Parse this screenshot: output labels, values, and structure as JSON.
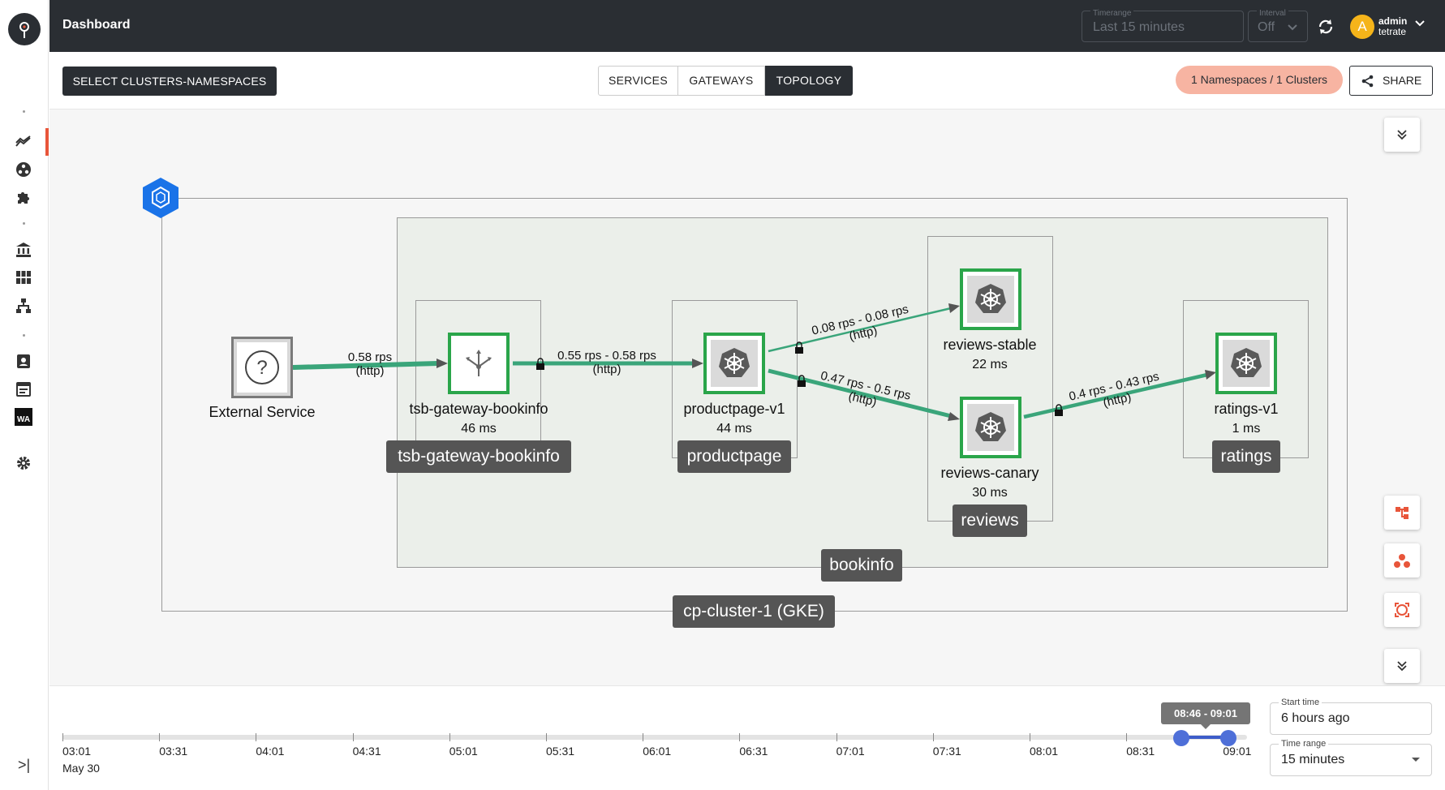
{
  "header": {
    "title": "Dashboard",
    "timerange_label": "Timerange",
    "timerange_value": "Last 15 minutes",
    "interval_label": "Interval",
    "interval_value": "Off",
    "user_initial": "A",
    "user_name": "admin",
    "user_org": "tetrate"
  },
  "toolbar": {
    "select_button": "SELECT CLUSTERS-NAMESPACES",
    "tabs": [
      {
        "label": "SERVICES",
        "active": false
      },
      {
        "label": "GATEWAYS",
        "active": false
      },
      {
        "label": "TOPOLOGY",
        "active": true
      }
    ],
    "namespace_badge": "1 Namespaces / 1 Clusters",
    "share_label": "SHARE"
  },
  "sidebar": {
    "icons": [
      "metrics-icon",
      "services-icon",
      "extensions-icon",
      "organization-icon",
      "workspaces-icon",
      "hierarchy-icon",
      "profile-icon",
      "calendar-icon",
      "wa-icon",
      "settings-icon"
    ],
    "active": "metrics-icon",
    "wa_text": "WA"
  },
  "topology": {
    "cluster_label": "cp-cluster-1 (GKE)",
    "namespace_label": "bookinfo",
    "app_labels": {
      "gateway": "tsb-gateway-bookinfo",
      "productpage": "productpage",
      "reviews": "reviews",
      "ratings": "ratings"
    },
    "nodes": {
      "external": {
        "name": "External Service"
      },
      "gateway": {
        "name": "tsb-gateway-bookinfo",
        "latency": "46 ms"
      },
      "productpage": {
        "name": "productpage-v1",
        "latency": "44 ms"
      },
      "reviews_stable": {
        "name": "reviews-stable",
        "latency": "22 ms"
      },
      "reviews_canary": {
        "name": "reviews-canary",
        "latency": "30 ms"
      },
      "ratings": {
        "name": "ratings-v1",
        "latency": "1 ms"
      }
    },
    "edges": {
      "e1": {
        "rate": "0.58 rps",
        "protocol": "(http)"
      },
      "e2": {
        "rate": "0.55 rps - 0.58 rps",
        "protocol": "(http)"
      },
      "e3": {
        "rate": "0.08 rps - 0.08 rps",
        "protocol": "(http)"
      },
      "e4": {
        "rate": "0.47 rps - 0.5 rps",
        "protocol": "(http)"
      },
      "e5": {
        "rate": "0.4 rps - 0.43 rps",
        "protocol": "(http)"
      }
    },
    "colors": {
      "edge": "#3aa57a",
      "node_border": "#2aa54a",
      "cluster_badge": "#1a73e8"
    }
  },
  "timeline": {
    "ticks": [
      "03:01",
      "03:31",
      "04:01",
      "04:31",
      "05:01",
      "05:31",
      "06:01",
      "06:31",
      "07:01",
      "07:31",
      "08:01",
      "08:31",
      "09:01"
    ],
    "date": "May 30",
    "selected_range": "08:46 - 09:01",
    "start_time_label": "Start time",
    "start_time_value": "6 hours ago",
    "time_range_label": "Time range",
    "time_range_value": "15 minutes"
  }
}
